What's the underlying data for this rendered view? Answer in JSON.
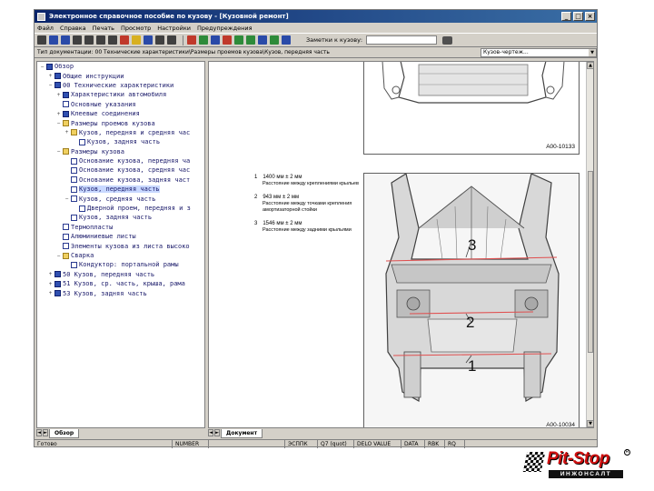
{
  "window": {
    "title": "Электронное справочное пособие по кузову - [Кузовной ремонт]",
    "minimize": "_",
    "maximize": "□",
    "close": "×"
  },
  "menu": {
    "items": [
      "Файл",
      "Справка",
      "Печать",
      "Просмотр",
      "Настройки",
      "Предупреждения"
    ]
  },
  "toolbar": {
    "icons": [
      "print-icon",
      "back-icon",
      "forward-icon",
      "first-page-icon",
      "prev-page-icon",
      "next-page-icon",
      "last-page-icon",
      "home-icon",
      "bookmark-icon",
      "search-icon",
      "binoculars-icon",
      "zoom-icon"
    ],
    "icons2": [
      "car-red-icon",
      "car-green-icon",
      "car-blue-icon",
      "tool-icon",
      "wrench-icon",
      "hammer-icon",
      "info-icon",
      "note-icon",
      "exit-icon"
    ],
    "jump_label": "Заметки к кузову:",
    "jump_value": ""
  },
  "pathbar": {
    "path": "Тип документации: 00 Технические характеристики\\Размеры проемов кузова\\Кузов, передняя часть",
    "combo_value": "Кузов-чертеж..."
  },
  "tree": [
    {
      "level": 0,
      "exp": "−",
      "icon": "book",
      "label": "Обзор"
    },
    {
      "level": 1,
      "exp": "+",
      "icon": "book",
      "label": "Общие инструкции"
    },
    {
      "level": 1,
      "exp": "−",
      "icon": "book",
      "label": "00 Технические характеристики"
    },
    {
      "level": 2,
      "exp": "+",
      "icon": "book",
      "label": "Характеристики автомобиля"
    },
    {
      "level": 2,
      "exp": "",
      "icon": "doc",
      "label": "Основные указания"
    },
    {
      "level": 2,
      "exp": "+",
      "icon": "book",
      "label": "Клеевые соединения"
    },
    {
      "level": 2,
      "exp": "−",
      "icon": "folder",
      "label": "Размеры проемов кузова"
    },
    {
      "level": 3,
      "exp": "+",
      "icon": "folder",
      "label": "Кузов, передняя и средняя час"
    },
    {
      "level": 4,
      "exp": "",
      "icon": "doc",
      "label": "Кузов, задняя часть"
    },
    {
      "level": 2,
      "exp": "−",
      "icon": "folder",
      "label": "Размеры кузова"
    },
    {
      "level": 3,
      "exp": "",
      "icon": "doc",
      "label": "Основание кузова, передняя ча"
    },
    {
      "level": 3,
      "exp": "",
      "icon": "doc",
      "label": "Основание кузова, средняя час"
    },
    {
      "level": 3,
      "exp": "",
      "icon": "doc",
      "label": "Основание кузова, задняя част"
    },
    {
      "level": 3,
      "exp": "",
      "icon": "doc",
      "label": "Кузов, передняя часть",
      "selected": true
    },
    {
      "level": 3,
      "exp": "−",
      "icon": "doc",
      "label": "Кузов, средняя часть"
    },
    {
      "level": 4,
      "exp": "",
      "icon": "doc",
      "label": "Дверной проем, передняя и з"
    },
    {
      "level": 3,
      "exp": "",
      "icon": "doc",
      "label": "Кузов, задняя часть"
    },
    {
      "level": 2,
      "exp": "",
      "icon": "doc",
      "label": "Термопласты"
    },
    {
      "level": 2,
      "exp": "",
      "icon": "doc",
      "label": "Алюминиевые листы"
    },
    {
      "level": 2,
      "exp": "",
      "icon": "doc",
      "label": "Элементы кузова из листа высоко"
    },
    {
      "level": 2,
      "exp": "−",
      "icon": "folder",
      "label": "Сварка"
    },
    {
      "level": 3,
      "exp": "",
      "icon": "doc",
      "label": "Кондуктор: портальной рамы"
    },
    {
      "level": 1,
      "exp": "+",
      "icon": "book",
      "label": "50 Кузов, передняя часть"
    },
    {
      "level": 1,
      "exp": "+",
      "icon": "book",
      "label": "51 Кузов, ср. часть, крыша, рама"
    },
    {
      "level": 1,
      "exp": "+",
      "icon": "book",
      "label": "53 Кузов, задняя часть"
    }
  ],
  "left_tabs": {
    "active": "Обзор"
  },
  "doc_tabs": {
    "active": "Документ"
  },
  "figure_top": {
    "id": "A00-10133"
  },
  "figure_main": {
    "id": "A00-10034",
    "callouts": [
      "3",
      "2",
      "1"
    ]
  },
  "measurements": [
    {
      "num": "1",
      "value": "1400 мм ± 2 мм",
      "desc": "Расстояние между креплениями крыльев"
    },
    {
      "num": "2",
      "value": "943 мм ± 2 мм",
      "desc": "Расстояние между точками крепления амортизаторной стойки"
    },
    {
      "num": "3",
      "value": "1546 мм ± 2 мм",
      "desc": "Расстояние между задними крыльями"
    }
  ],
  "status": [
    "Готово",
    "NUMBER",
    "",
    "ЭСППК",
    "Q7 (quot)",
    "DELO VALUE",
    "DATA",
    "RBK",
    "RQ"
  ],
  "logo": {
    "main": "Pit-Stop",
    "sub": "ИНЖОНСАЛТ",
    "reg": "R"
  }
}
